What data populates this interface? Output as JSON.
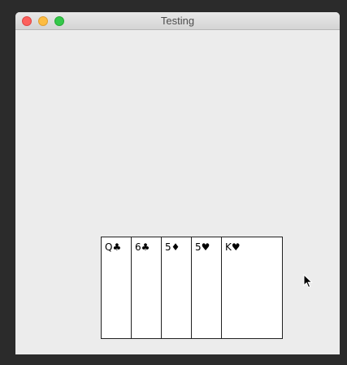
{
  "window": {
    "title": "Testing"
  },
  "hand": {
    "cards": [
      {
        "label": "Q♣"
      },
      {
        "label": "6♣"
      },
      {
        "label": "5♦"
      },
      {
        "label": "5♥"
      },
      {
        "label": "K♥"
      }
    ]
  },
  "icons": {
    "close": "close-traffic-light",
    "minimize": "minimize-traffic-light",
    "zoom": "zoom-traffic-light",
    "cursor": "arrow-pointer-icon"
  },
  "colors": {
    "close": "#fc605c",
    "minimize": "#fdbc40",
    "zoom": "#34c84a",
    "window_background": "#ececec",
    "card_background": "#ffffff",
    "card_border": "#222222"
  }
}
